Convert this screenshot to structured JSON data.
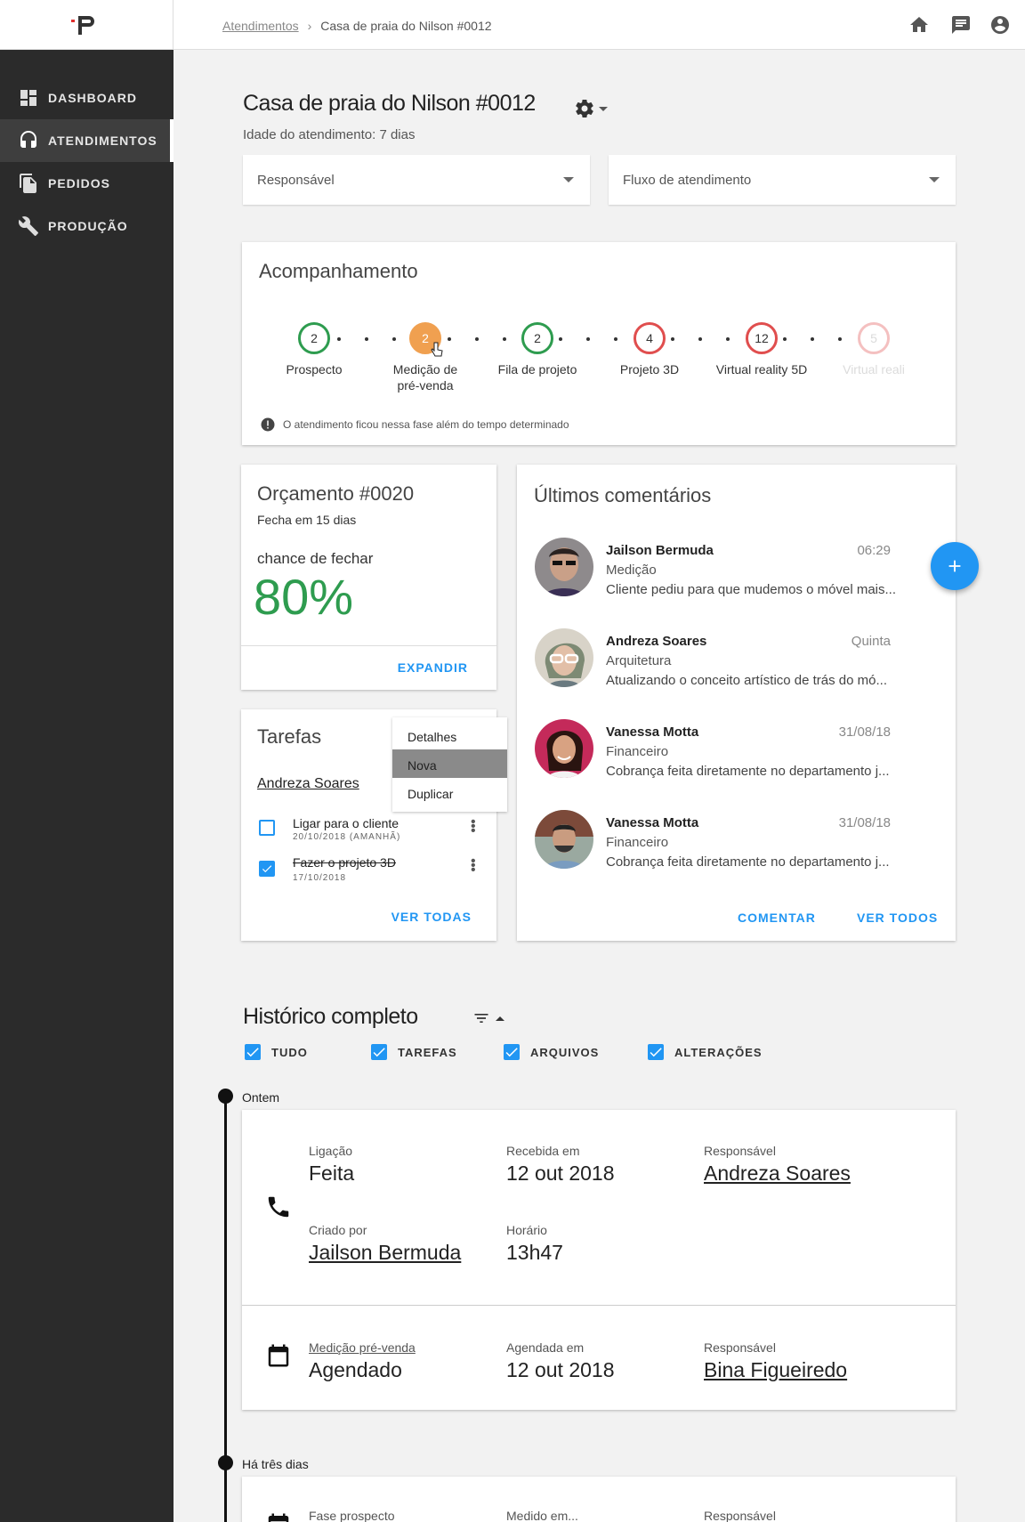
{
  "sidebar": {
    "items": [
      {
        "label": "DASHBOARD",
        "icon": "dashboard-icon"
      },
      {
        "label": "ATENDIMENTOS",
        "icon": "headset-icon"
      },
      {
        "label": "PEDIDOS",
        "icon": "documents-icon"
      },
      {
        "label": "PRODUÇÃO",
        "icon": "wrench-icon"
      }
    ],
    "active": "ATENDIMENTOS"
  },
  "header": {
    "breadcrumb": {
      "parent": "Atendimentos",
      "current": "Casa de praia do Nilson #0012"
    },
    "icons": [
      "home-icon",
      "chat-icon",
      "account-icon"
    ]
  },
  "page": {
    "title": "Casa de praia do Nilson #0012",
    "age": "Idade do atendimento: 7 dias",
    "responsavel_placeholder": "Responsável",
    "fluxo_placeholder": "Fluxo de atendimento"
  },
  "tracking": {
    "title": "Acompanhamento",
    "steps": [
      {
        "count": "2",
        "label": "Prospecto",
        "status": "ok"
      },
      {
        "count": "2",
        "label": "Medição de pré-venda",
        "status": "current"
      },
      {
        "count": "2",
        "label": "Fila de projeto",
        "status": "ok"
      },
      {
        "count": "4",
        "label": "Projeto 3D",
        "status": "late"
      },
      {
        "count": "12",
        "label": "Virtual reality 5D",
        "status": "late"
      },
      {
        "count": "5",
        "label": "Virtual reali",
        "status": "faded"
      }
    ],
    "note": "O atendimento ficou nessa fase além do tempo determinado"
  },
  "budget": {
    "title": "Orçamento #0020",
    "closes": "Fecha em 15 dias",
    "chance_label": "chance de fechar",
    "chance_value": "80%",
    "expand": "EXPANDIR"
  },
  "tasks": {
    "title": "Tarefas",
    "assignee": "Andreza Soares",
    "items": [
      {
        "text": "Ligar para o cliente",
        "date": "20/10/2018 (AMANHÃ)",
        "done": false
      },
      {
        "text": "Fazer o projeto 3D",
        "date": "17/10/2018",
        "done": true
      }
    ],
    "menu": [
      "Detalhes",
      "Nova",
      "Duplicar"
    ],
    "view_all": "VER TODAS"
  },
  "comments": {
    "title": "Últimos comentários",
    "items": [
      {
        "name": "Jailson Bermuda",
        "time": "06:29",
        "dept": "Medição",
        "text": "Cliente pediu para que mudemos o móvel mais..."
      },
      {
        "name": "Andreza Soares",
        "time": "Quinta",
        "dept": "Arquitetura",
        "text": "Atualizando o conceito artístico de trás do mó..."
      },
      {
        "name": "Vanessa Motta",
        "time": "31/08/18",
        "dept": "Financeiro",
        "text": "Cobrança feita diretamente no departamento j..."
      },
      {
        "name": "Vanessa Motta",
        "time": "31/08/18",
        "dept": "Financeiro",
        "text": "Cobrança feita diretamente no departamento j..."
      }
    ],
    "comment_btn": "COMENTAR",
    "view_all": "VER TODOS"
  },
  "history": {
    "title": "Histórico completo",
    "filters": [
      "TUDO",
      "TAREFAS",
      "ARQUIVOS",
      "ALTERAÇÕES"
    ],
    "groups": [
      {
        "label": "Ontem"
      },
      {
        "label": "Há três dias"
      }
    ],
    "call": {
      "type_key": "Ligação",
      "type_val": "Feita",
      "received_key": "Recebida em",
      "received_val": "12 out 2018",
      "resp_key": "Responsável",
      "resp_val": "Andreza Soares",
      "created_key": "Criado por",
      "created_val": "Jailson Bermuda",
      "time_key": "Horário",
      "time_val": "13h47"
    },
    "measure": {
      "type_key": "Medição pré-venda",
      "type_val": "Agendado",
      "sched_key": "Agendada em",
      "sched_val": "12 out 2018",
      "resp_key": "Responsável",
      "resp_val": "Bina Figueiredo"
    },
    "third": {
      "k1": "Fase prospecto",
      "k2": "Medido em...",
      "k3": "Responsável"
    }
  },
  "colors": {
    "accent": "#2196f3",
    "green": "#2e9c4f",
    "red": "#e04e4e",
    "orange": "#f0a050"
  }
}
